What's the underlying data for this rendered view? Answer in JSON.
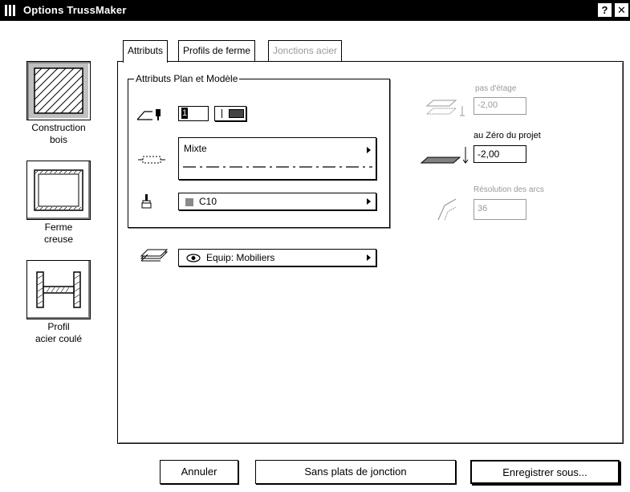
{
  "window": {
    "title": "Options TrussMaker",
    "help_label": "?",
    "close_label": "✕"
  },
  "sidebar": {
    "items": [
      {
        "label_line1": "Construction",
        "label_line2": "bois",
        "icon": "wood-hatch-icon",
        "selected": true
      },
      {
        "label_line1": "Ferme",
        "label_line2": "creuse",
        "icon": "hollow-frame-icon",
        "selected": false
      },
      {
        "label_line1": "Profil",
        "label_line2": "acier coulé",
        "icon": "i-beam-icon",
        "selected": false
      }
    ]
  },
  "tabs": [
    {
      "label": "Attributs",
      "state": "active"
    },
    {
      "label": "Profils de ferme",
      "state": "normal"
    },
    {
      "label": "Jonctions acier",
      "state": "disabled"
    }
  ],
  "attributes_group": {
    "title": "Attributs Plan et Modèle",
    "pen_value": "1",
    "line_type": "Mixte",
    "material": "C10",
    "layer": "Equip: Mobiliers"
  },
  "right_fields": {
    "story_label": "pas d'étage",
    "story_value": "-2,00",
    "project_zero_label": "au Zéro du projet",
    "project_zero_value": "-2,00",
    "arc_resolution_label": "Résolution des arcs",
    "arc_resolution_value": "36"
  },
  "buttons": {
    "cancel": "Annuler",
    "no_plates": "Sans plats de jonction",
    "save_as": "Enregistrer sous..."
  },
  "colors": {
    "title_bar": "#000000",
    "material_swatch": "#8a8a8a",
    "disabled_text": "#999999"
  }
}
